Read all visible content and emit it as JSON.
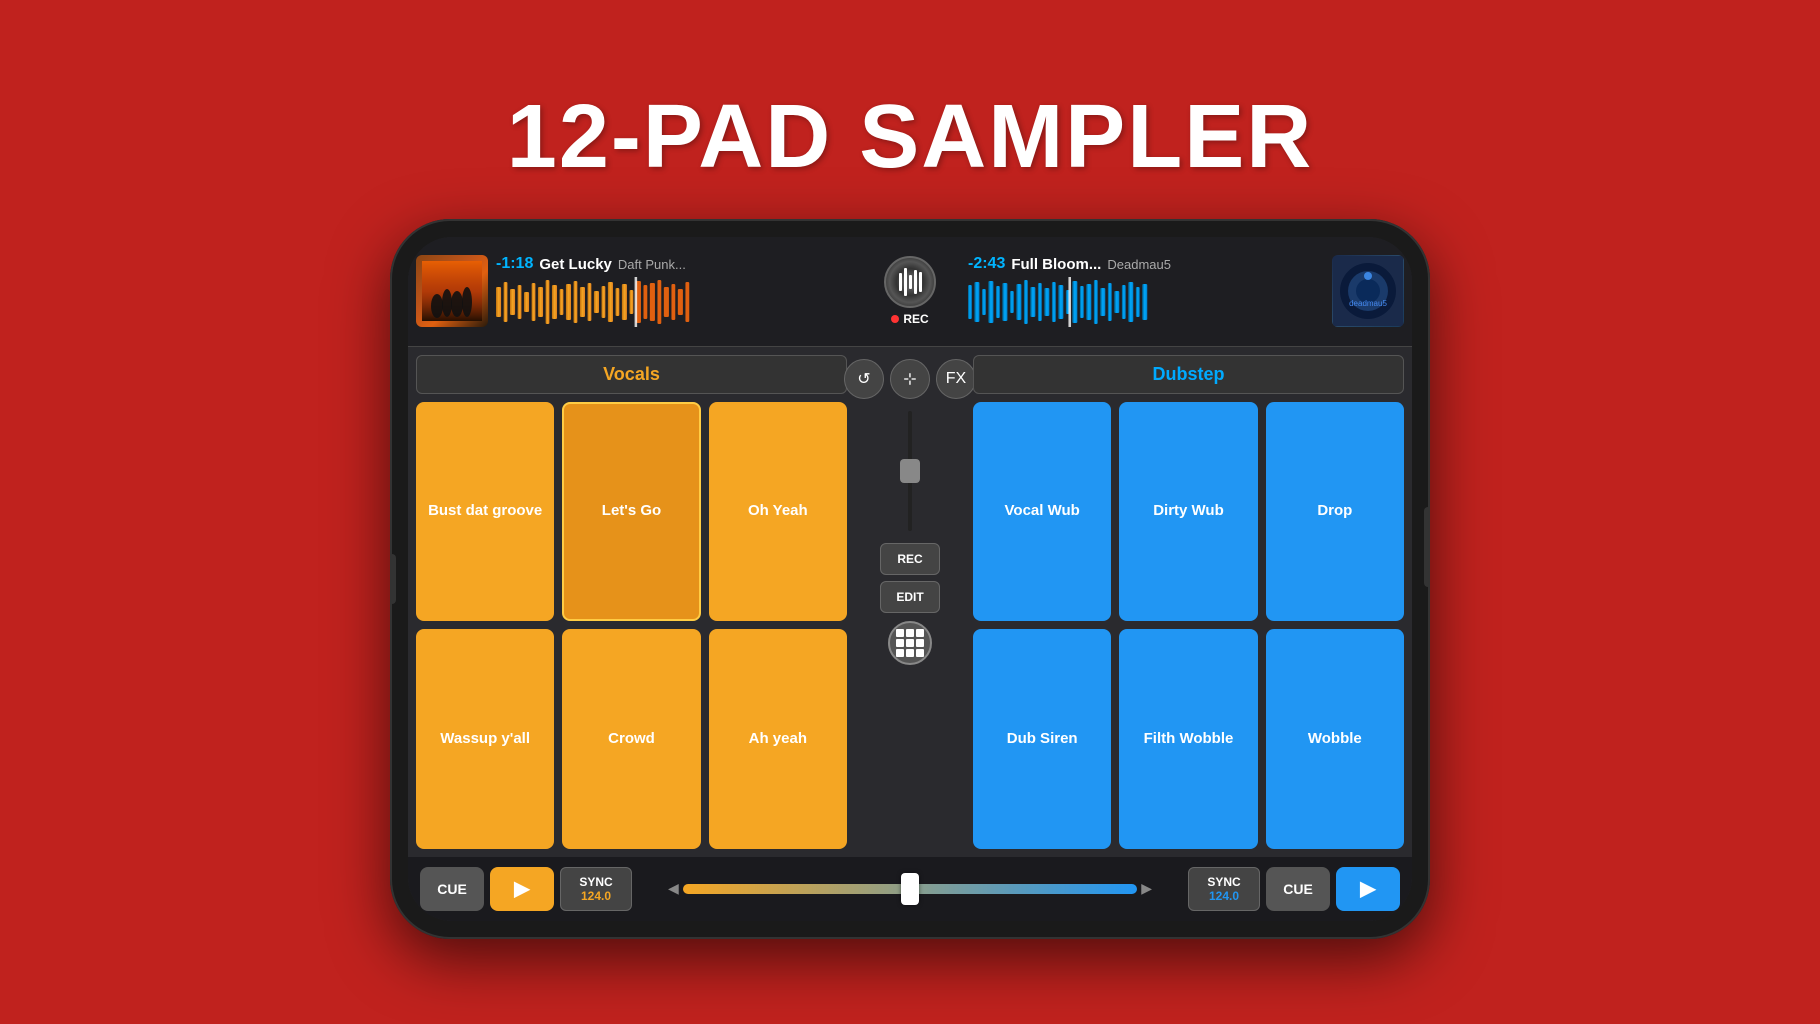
{
  "page": {
    "title": "12-PAD SAMPLER",
    "background_color": "#c0221e"
  },
  "phone": {
    "deck_left": {
      "time": "-1:18",
      "track_title": "Get Lucky",
      "artist": "Daft Punk...",
      "waveform_color": "#f5a623"
    },
    "deck_right": {
      "time": "-2:43",
      "track_title": "Full Bloom...",
      "artist": "Deadmau5",
      "waveform_color": "#00aaff"
    },
    "rec_label": "REC",
    "sampler_left": {
      "category": "Vocals",
      "pads": [
        {
          "label": "Bust dat groove",
          "state": "normal"
        },
        {
          "label": "Let's Go",
          "state": "active"
        },
        {
          "label": "Oh Yeah",
          "state": "normal"
        },
        {
          "label": "Wassup y'all",
          "state": "normal"
        },
        {
          "label": "Crowd",
          "state": "normal"
        },
        {
          "label": "Ah yeah",
          "state": "normal"
        }
      ]
    },
    "sampler_right": {
      "category": "Dubstep",
      "pads": [
        {
          "label": "Vocal Wub",
          "state": "normal"
        },
        {
          "label": "Dirty Wub",
          "state": "normal"
        },
        {
          "label": "Drop",
          "state": "normal"
        },
        {
          "label": "Dub Siren",
          "state": "normal"
        },
        {
          "label": "Filth Wobble",
          "state": "normal"
        },
        {
          "label": "Wobble",
          "state": "normal"
        }
      ]
    },
    "center_controls": {
      "loop_icon": "↺",
      "mixer_icon": "⊞",
      "fx_label": "FX",
      "rec_button": "REC",
      "edit_button": "EDIT"
    },
    "transport_left": {
      "cue_label": "CUE",
      "play_symbol": "▶",
      "sync_label": "SYNC",
      "sync_bpm": "124.0"
    },
    "transport_right": {
      "sync_label": "SYNC",
      "sync_bpm": "124.0",
      "cue_label": "CUE",
      "play_symbol": "▶"
    }
  }
}
